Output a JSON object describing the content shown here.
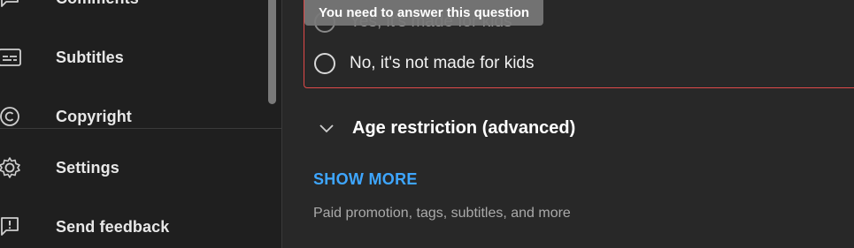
{
  "sidebar": {
    "items": [
      {
        "label": "Comments",
        "icon": "comment-icon"
      },
      {
        "label": "Subtitles",
        "icon": "subtitles-icon"
      },
      {
        "label": "Copyright",
        "icon": "copyright-icon"
      },
      {
        "label": "Settings",
        "icon": "gear-icon"
      },
      {
        "label": "Send feedback",
        "icon": "feedback-icon"
      }
    ]
  },
  "main": {
    "tooltip": "You need to answer this question",
    "audience": {
      "options": [
        {
          "label": "Yes, it's made for kids"
        },
        {
          "label": "No, it's not made for kids"
        }
      ]
    },
    "age_restriction_label": "Age restriction (advanced)",
    "show_more_label": "SHOW MORE",
    "show_more_subtext": "Paid promotion, tags, subtitles, and more"
  },
  "colors": {
    "accent": "#3ea6ff",
    "error_border": "#e04a4a",
    "sidebar_bg": "#1f1f1f",
    "main_bg": "#282828"
  }
}
